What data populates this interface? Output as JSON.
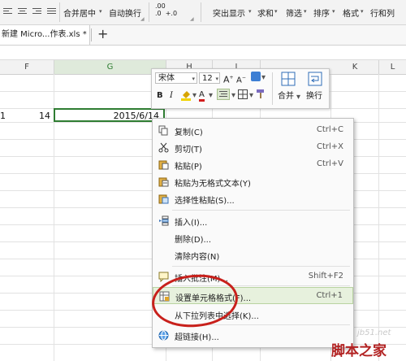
{
  "ribbon": {
    "merge_center": "合并居中",
    "wrap_text": "自动换行",
    "number_fmt": ".00\n.0  +.0",
    "highlight": "突出显示",
    "sum": "求和",
    "filter": "筛选",
    "sort": "排序",
    "format": "格式",
    "row_col": "行和列"
  },
  "tabbar": {
    "doc_tab": "新建 Micro...作表.xls *",
    "new_tab": "+"
  },
  "grid": {
    "columns": [
      "F",
      "G",
      "H",
      "I",
      "K",
      "L"
    ],
    "row_partial": "1",
    "cell_f": "14",
    "cell_g": "2015/6/14"
  },
  "mini_toolbar": {
    "font": "宋体",
    "size": "12",
    "bold": "B",
    "italic": "I",
    "font_color": "A",
    "merge": "合并",
    "wrap": "换行",
    "grow_font": "A+",
    "shrink_font": "A-"
  },
  "context_menu": {
    "items": [
      {
        "label": "复制(C)",
        "shortcut": "Ctrl+C",
        "icon": "copy-icon"
      },
      {
        "label": "剪切(T)",
        "shortcut": "Ctrl+X",
        "icon": "scissors-icon"
      },
      {
        "label": "粘贴(P)",
        "shortcut": "Ctrl+V",
        "icon": "paste-icon"
      },
      {
        "label": "粘贴为无格式文本(Y)",
        "shortcut": "",
        "icon": "paste-text-icon"
      },
      {
        "label": "选择性粘贴(S)...",
        "shortcut": "",
        "icon": "paste-special-icon"
      },
      {
        "label": "插入(I)...",
        "shortcut": "",
        "icon": "insert-icon"
      },
      {
        "label": "删除(D)...",
        "shortcut": "",
        "icon": ""
      },
      {
        "label": "清除内容(N)",
        "shortcut": "",
        "icon": ""
      },
      {
        "label": "插入批注(M)...",
        "shortcut": "Shift+F2",
        "icon": "comment-icon"
      },
      {
        "label": "设置单元格格式(F)...",
        "shortcut": "Ctrl+1",
        "icon": "format-cells-icon"
      },
      {
        "label": "从下拉列表中选择(K)...",
        "shortcut": "",
        "icon": ""
      },
      {
        "label": "超链接(H)...",
        "shortcut": "",
        "icon": "hyperlink-icon"
      }
    ]
  },
  "watermark": {
    "site": "jb51.net",
    "name": "脚本之家"
  },
  "colors": {
    "selection_green": "#2f7d32",
    "highlight_bg": "#e7f1dd",
    "annotation_red": "#c8201b"
  }
}
